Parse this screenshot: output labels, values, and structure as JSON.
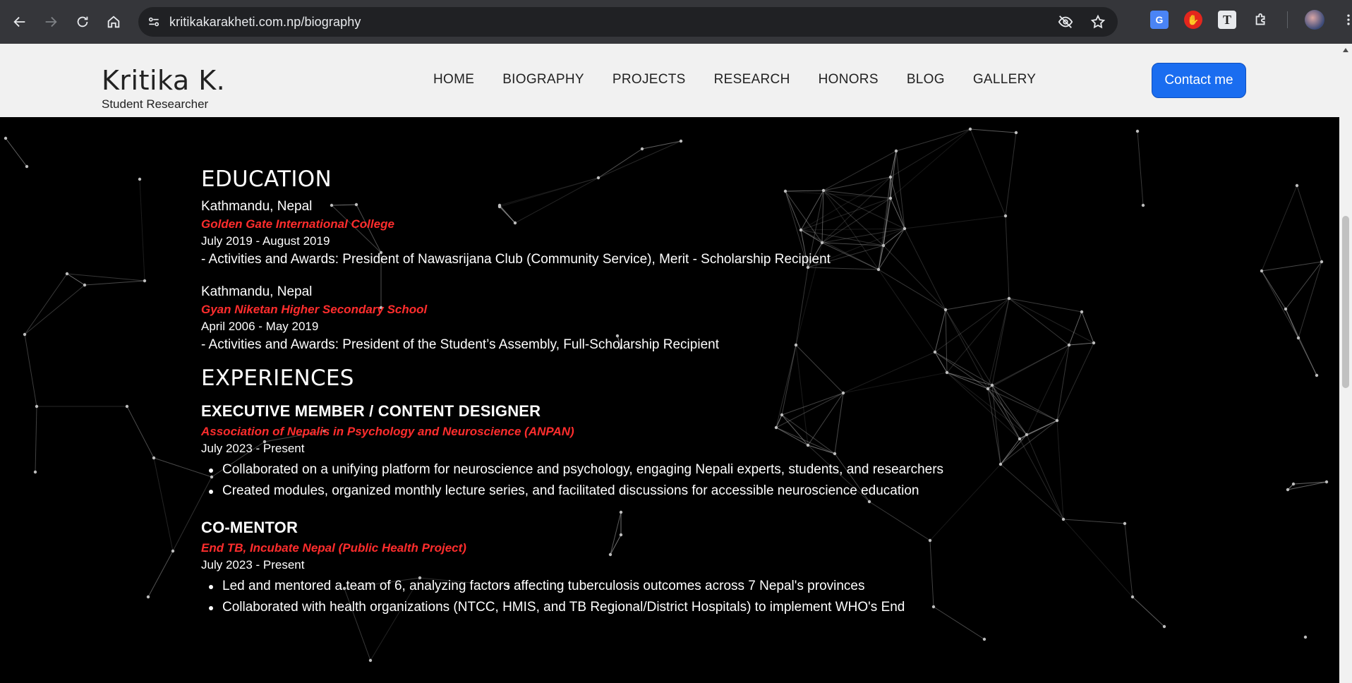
{
  "browser": {
    "url": "kritikakarakheti.com.np/biography"
  },
  "header": {
    "brand_name": "Kritika K.",
    "brand_subtitle": "Student Researcher",
    "nav": [
      "HOME",
      "BIOGRAPHY",
      "PROJECTS",
      "RESEARCH",
      "HONORS",
      "BLOG",
      "GALLERY"
    ],
    "contact_label": "Contact me"
  },
  "education": {
    "title": "EDUCATION",
    "items": [
      {
        "location": "Kathmandu, Nepal",
        "org": "Golden Gate International College",
        "dates": "July 2019 - August 2019",
        "desc": "- Activities and Awards: President of Nawasrijana Club (Community Service), Merit - Scholarship Recipient"
      },
      {
        "location": "Kathmandu, Nepal",
        "org": "Gyan Niketan Higher Secondary School",
        "dates": "April 2006 - May 2019",
        "desc": "- Activities and Awards: President of the Student’s Assembly, Full-Scholarship Recipient"
      }
    ]
  },
  "experiences": {
    "title": "EXPERIENCES",
    "items": [
      {
        "role": "EXECUTIVE MEMBER / CONTENT DESIGNER",
        "org": "Association of Nepalis in Psychology and Neuroscience (ANPAN)",
        "dates": "July 2023 - Present",
        "bullets": [
          "Collaborated on a unifying platform for neuroscience and psychology, engaging Nepali experts, students, and researchers",
          "Created modules, organized monthly lecture series, and facilitated discussions for accessible neuroscience education"
        ]
      },
      {
        "role": "CO-MENTOR",
        "org": "End TB, Incubate Nepal (Public Health Project)",
        "dates": "July 2023 - Present",
        "bullets": [
          "Led and mentored a team of 6, analyzing factors affecting tuberculosis outcomes across 7 Nepal's provinces",
          "Collaborated with health organizations (NTCC, HMIS, and TB Regional/District Hospitals) to implement WHO's End"
        ]
      }
    ]
  },
  "colors": {
    "accent_red": "#ff2d2d",
    "contact_blue": "#1a6df0",
    "header_bg": "#f1f1f1",
    "page_bg": "#000000"
  }
}
